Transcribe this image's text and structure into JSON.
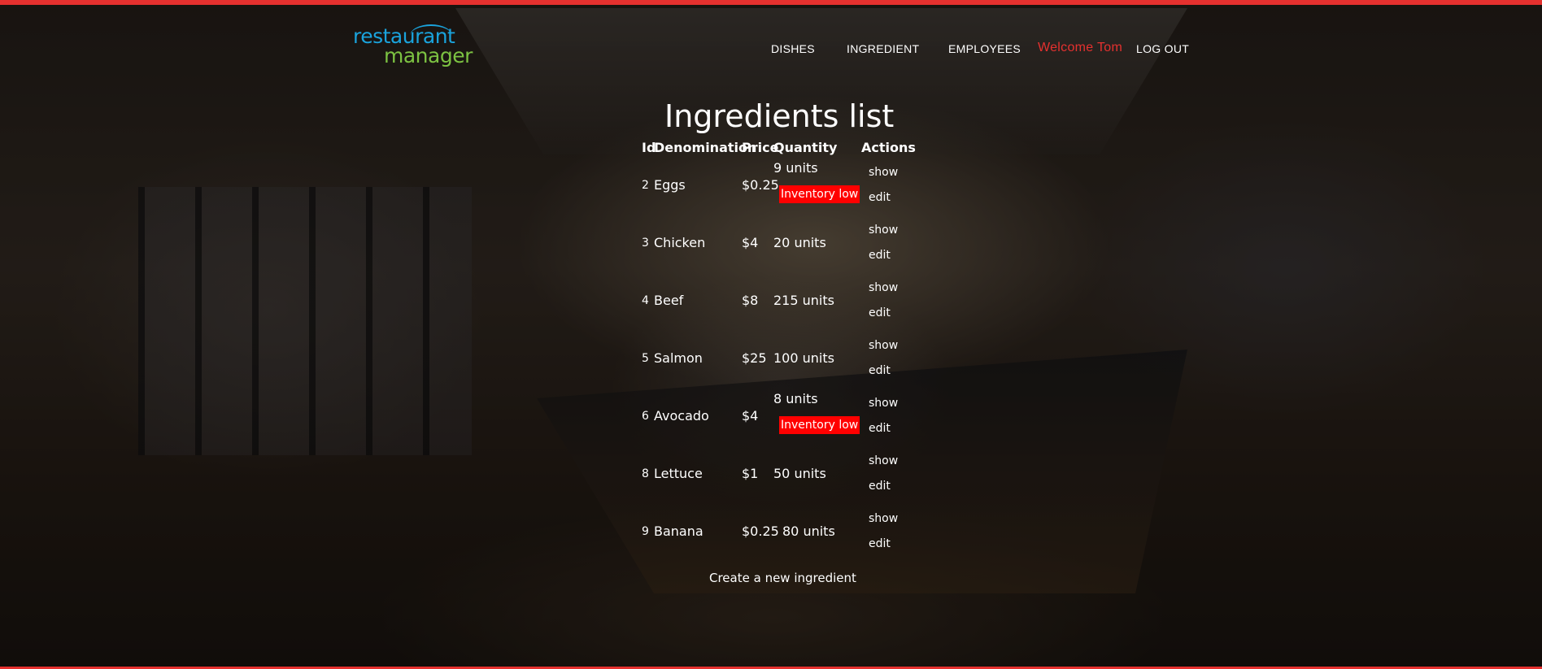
{
  "brand": {
    "line1": "restaurant",
    "line2": "manager"
  },
  "nav": {
    "dishes": "DISHES",
    "ingredient": "INGREDIENT",
    "employees": "EMPLOYEES",
    "welcome": "Welcome Tom",
    "logout": "LOG OUT"
  },
  "page": {
    "title": "Ingredients list"
  },
  "table": {
    "headers": [
      "Id",
      "Denomination",
      "Price",
      "Quantity",
      "Actions"
    ],
    "rows": [
      {
        "id": "2",
        "name": "Eggs",
        "price": "$0.25",
        "qty": "9 units",
        "badge": "Inventory low",
        "show": "show",
        "edit": "edit"
      },
      {
        "id": "3",
        "name": "Chicken",
        "price": "$4",
        "qty": "20 units",
        "show": "show",
        "edit": "edit"
      },
      {
        "id": "4",
        "name": "Beef",
        "price": "$8",
        "qty": "215 units",
        "show": "show",
        "edit": "edit"
      },
      {
        "id": "5",
        "name": "Salmon",
        "price": "$25",
        "qty": "100 units",
        "show": "show",
        "edit": "edit"
      },
      {
        "id": "6",
        "name": "Avocado",
        "price": "$4",
        "qty": "8 units",
        "badge": "Inventory low",
        "show": "show",
        "edit": "edit"
      },
      {
        "id": "8",
        "name": "Lettuce",
        "price": "$1",
        "qty": "50 units",
        "show": "show",
        "edit": "edit"
      },
      {
        "id": "9",
        "name": "Banana",
        "price": "$0.25",
        "qty": "80 units",
        "show": "show",
        "edit": "edit"
      }
    ]
  },
  "footer": {
    "create_link": "Create a new ingredient"
  },
  "colors": {
    "accent": "#e5312f",
    "badge": "#ff0000",
    "logo_blue": "#1aa3dc",
    "logo_green": "#7cc242"
  }
}
